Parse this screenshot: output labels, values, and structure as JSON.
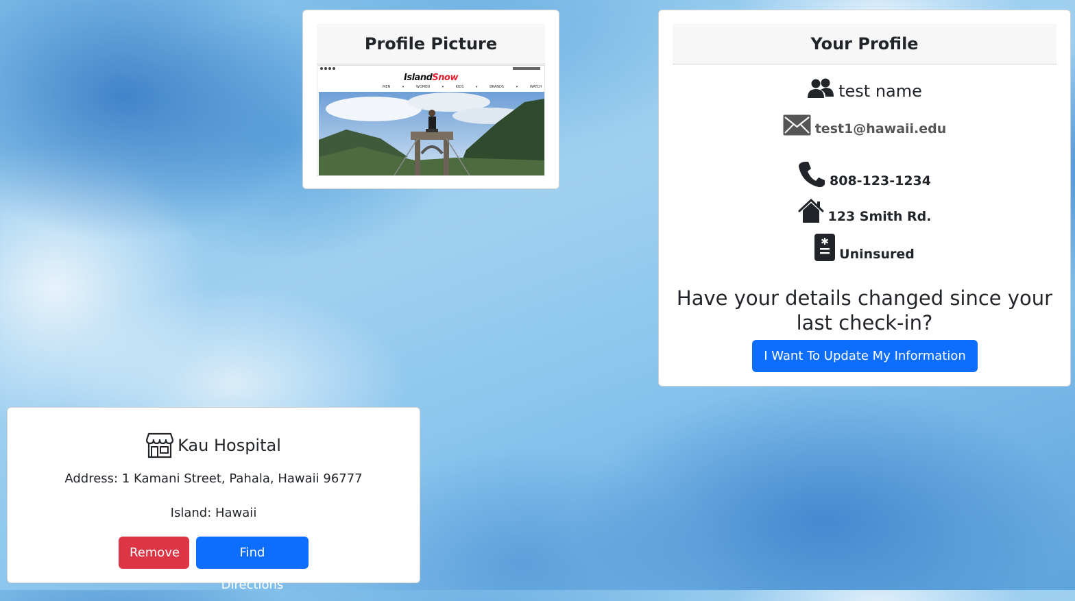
{
  "profile_picture": {
    "title": "Profile Picture",
    "image_logo_part1": "Island",
    "image_logo_part2": "Snow",
    "image_nav": "MEN ▾ WOMEN ▾ KIDS ▾ BRANDS ▾ WATCH"
  },
  "profile": {
    "title": "Your Profile",
    "name": "test name",
    "email": "test1@hawaii.edu",
    "phone": "808-123-1234",
    "address": "123 Smith Rd.",
    "insurance": "Uninsured",
    "update_question": "Have your details changed since your last check-in?",
    "update_button": "I Want To Update My Information",
    "icons": [
      "users-icon",
      "envelope-icon",
      "phone-icon",
      "house-icon",
      "medical-card-icon"
    ]
  },
  "hospital": {
    "name": "Kau Hospital",
    "address": "Address: 1 Kamani Street, Pahala, Hawaii 96777",
    "island": "Island: Hawaii",
    "remove_button": "Remove",
    "directions_button": "Find Directions",
    "icon": "shop-icon"
  },
  "colors": {
    "primary": "#0d6efd",
    "danger": "#dc3545",
    "card_header_bg": "#f7f7f7",
    "background": "#8cc6ee"
  }
}
